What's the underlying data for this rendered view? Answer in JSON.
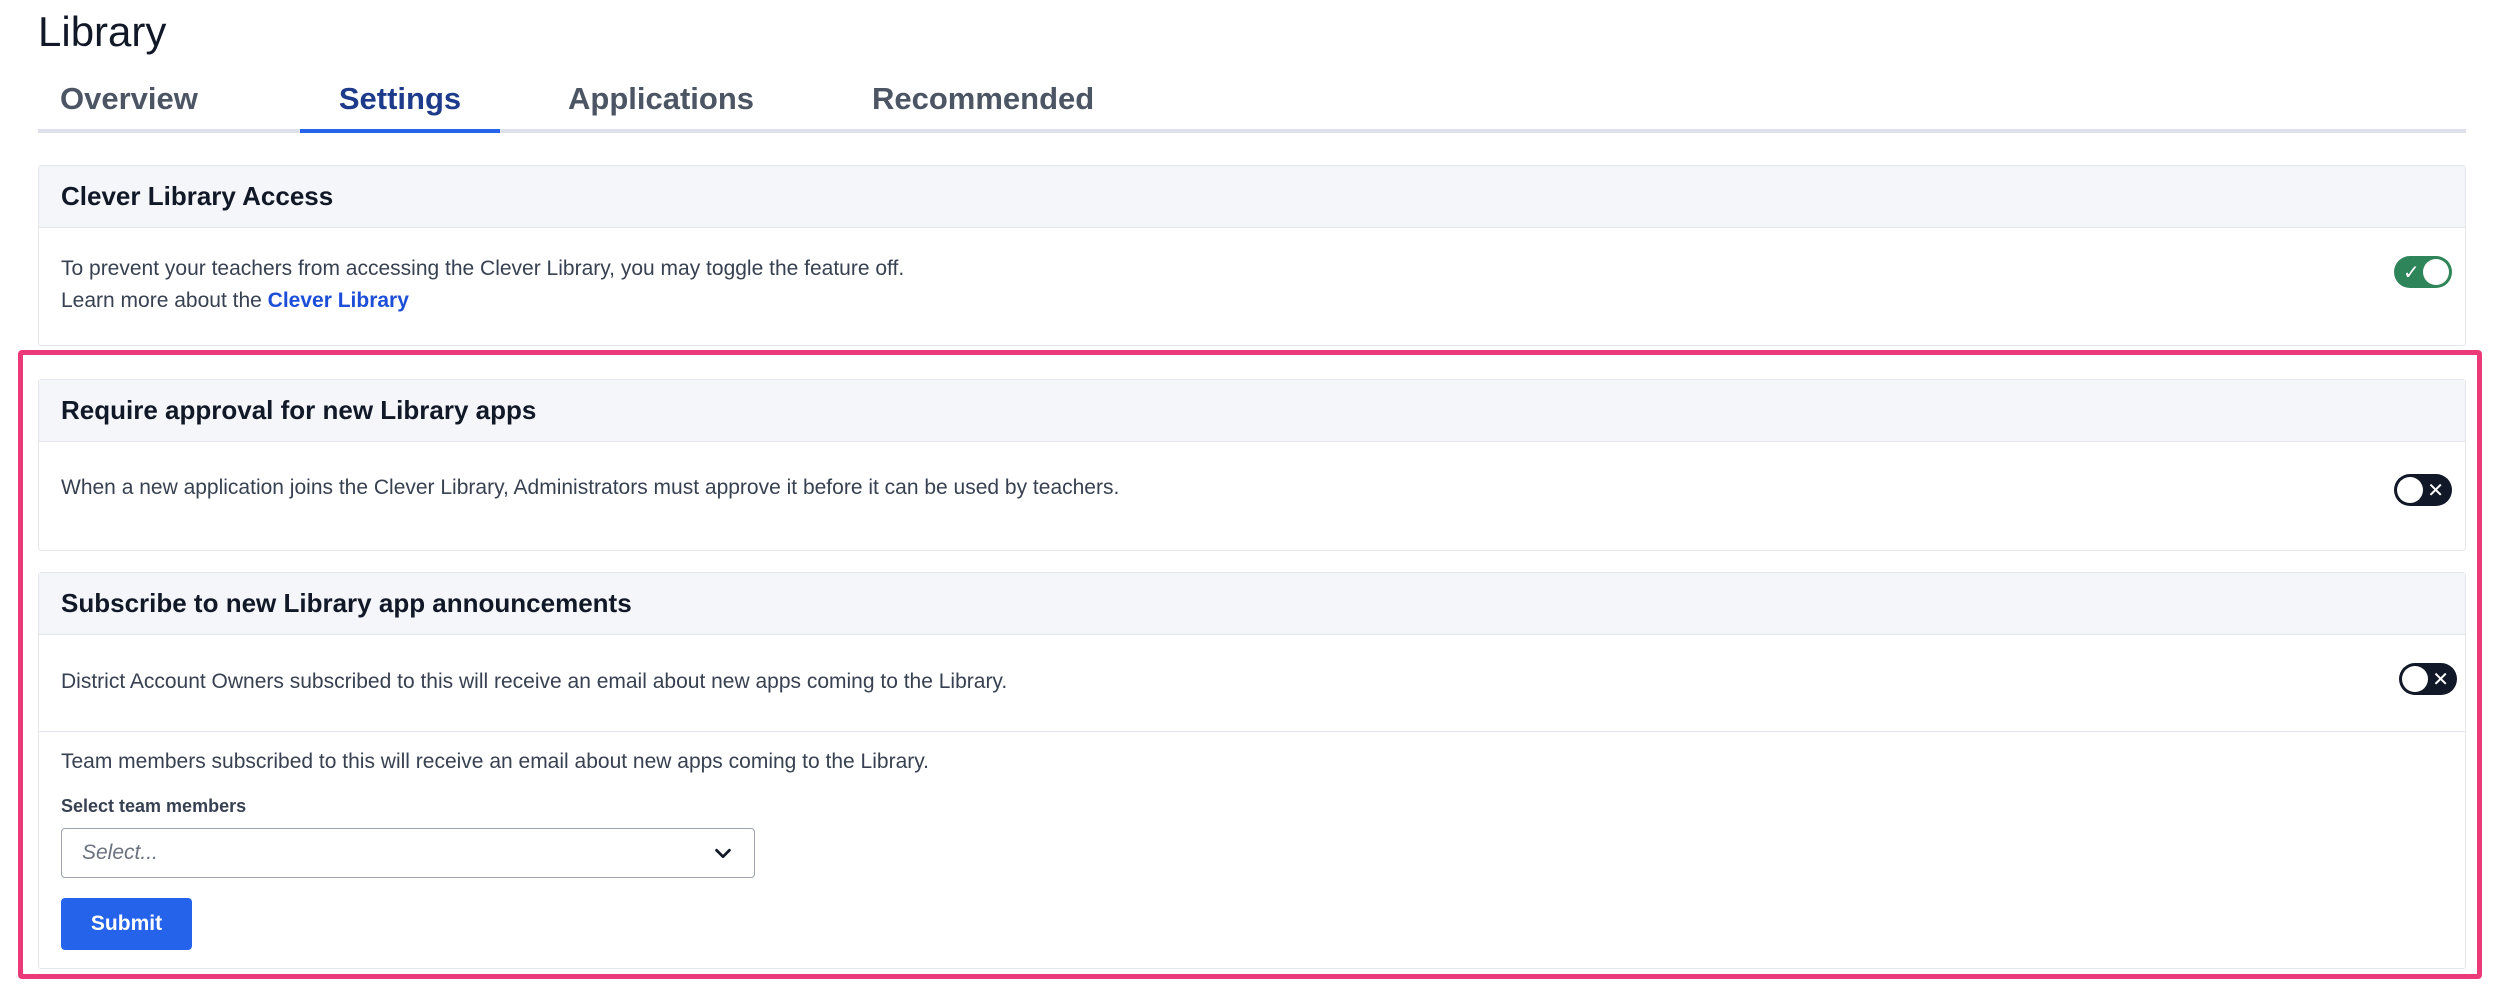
{
  "page": {
    "title": "Library"
  },
  "tabs": [
    {
      "label": "Overview",
      "active": false
    },
    {
      "label": "Settings",
      "active": true
    },
    {
      "label": "Applications",
      "active": false
    },
    {
      "label": "Recommended",
      "active": false
    }
  ],
  "access": {
    "title": "Clever Library Access",
    "description": "To prevent your teachers from accessing the Clever Library, you may toggle the feature off.",
    "learn_more_prefix": "Learn more about the",
    "learn_more_link": "Clever Library",
    "toggle_state": "on",
    "toggle_color": "#2f855a"
  },
  "approval": {
    "title": "Require approval for new Library apps",
    "description": "When a new application joins the Clever Library, Administrators must approve it before it can be used by teachers.",
    "toggle_state": "off"
  },
  "subscribe": {
    "title": "Subscribe to new Library app announcements",
    "owners_description": "District Account Owners subscribed to this will receive an email about new apps coming to the Library.",
    "owners_toggle_state": "off",
    "team_description": "Team members subscribed to this will receive an email about new apps coming to the Library.",
    "select_label": "Select team members",
    "select_placeholder": "Select...",
    "submit_label": "Submit"
  },
  "icons": {
    "toggle_on": "check-icon",
    "toggle_off": "x-icon",
    "select": "chevron-down-icon"
  },
  "colors": {
    "accent": "#2563eb",
    "highlight": "#ec3a78",
    "toggle_off": "#111827"
  }
}
